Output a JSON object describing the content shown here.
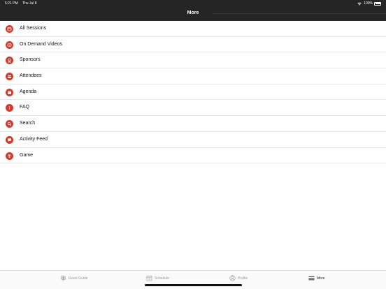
{
  "status_bar": {
    "time": "5:21 PM",
    "date": "Thu Jul 8",
    "battery": "100%"
  },
  "nav": {
    "title": "More"
  },
  "menu": {
    "items": [
      {
        "label": "All Sessions",
        "icon": "calendar-icon"
      },
      {
        "label": "On Demand Videos",
        "icon": "video-icon"
      },
      {
        "label": "Sponsors",
        "icon": "ribbon-icon"
      },
      {
        "label": "Attendees",
        "icon": "people-icon"
      },
      {
        "label": "Agenda",
        "icon": "calendar-icon"
      },
      {
        "label": "FAQ",
        "icon": "info-icon"
      },
      {
        "label": "Search",
        "icon": "search-icon"
      },
      {
        "label": "Activity Feed",
        "icon": "chat-icon"
      },
      {
        "label": "Game",
        "icon": "trophy-icon"
      }
    ]
  },
  "tab_bar": {
    "tabs": [
      {
        "label": "Event Guide",
        "icon": "signpost-icon"
      },
      {
        "label": "Schedule",
        "icon": "calendar-icon"
      },
      {
        "label": "Profile",
        "icon": "profile-icon"
      },
      {
        "label": "More",
        "icon": "menu-icon"
      }
    ],
    "active": "More"
  },
  "colors": {
    "accent": "#d13a2c",
    "header": "#252525"
  }
}
